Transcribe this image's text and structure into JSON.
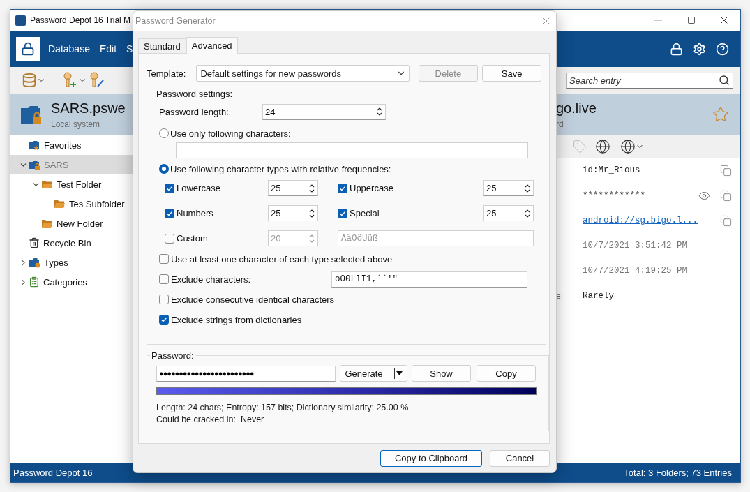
{
  "main_window": {
    "title": "Password Depot 16 Trial M",
    "menu": [
      "Database",
      "Edit",
      "S"
    ],
    "search": {
      "placeholder": "Search entry"
    },
    "database": {
      "name": "SARS.pswe",
      "location": "Local system"
    },
    "entry": {
      "title": "go.live",
      "subtitle": "rd"
    },
    "sidebar": {
      "items": [
        {
          "label": "Favorites",
          "kind": "favorites",
          "selected": false
        },
        {
          "label": "SARS",
          "kind": "database",
          "selected": true,
          "expanded": true,
          "children": [
            {
              "label": "Test Folder",
              "kind": "folder",
              "selected": false,
              "expanded": true,
              "children": [
                {
                  "label": "Tes Subfolder",
                  "kind": "folder",
                  "selected": false
                }
              ]
            },
            {
              "label": "New Folder",
              "kind": "folder",
              "selected": false
            }
          ]
        },
        {
          "label": "Recycle Bin",
          "kind": "recycle",
          "selected": false
        },
        {
          "label": "Types",
          "kind": "types",
          "selected": false,
          "expanded": false
        },
        {
          "label": "Categories",
          "kind": "categories",
          "selected": false,
          "expanded": false
        }
      ]
    },
    "fields": [
      {
        "kind": "text",
        "value": "id:Mr_Rious",
        "copyable": true
      },
      {
        "kind": "password",
        "value": "************",
        "copyable": true
      },
      {
        "kind": "link",
        "value": "android://sg.bigo.l...",
        "copyable": true
      },
      {
        "kind": "date",
        "value": "10/7/2021 3:51:42 PM",
        "copyable": false
      },
      {
        "kind": "date",
        "value": "10/7/2021 4:19:25 PM",
        "copyable": false
      },
      {
        "kind": "text",
        "label": "e:",
        "value": "Rarely",
        "copyable": false
      }
    ],
    "status_bar": [
      "Password Depot 16",
      "Total: 3 Folders; 73 Entries"
    ]
  },
  "dialog": {
    "title": "Password Generator",
    "tabs": [
      {
        "label": "Standard",
        "selected": false
      },
      {
        "label": "Advanced",
        "selected": true
      }
    ],
    "template": {
      "label": "Template:",
      "value": "Default settings for new passwords"
    },
    "template_buttons": [
      {
        "label": "Delete",
        "disabled": true
      },
      {
        "label": "Save",
        "disabled": false
      }
    ],
    "settings": {
      "title": "Password settings:",
      "length": {
        "label": "Password length:",
        "value": "24"
      },
      "modes": [
        {
          "kind": "chars",
          "label": "Use only following characters:",
          "selected": false
        },
        {
          "kind": "types",
          "label": "Use following character types with relative frequencies:",
          "selected": true
        }
      ],
      "char_types": [
        {
          "label": "Lowercase",
          "checked": true,
          "value": "25",
          "disabled": false
        },
        {
          "label": "Uppercase",
          "checked": true,
          "value": "25",
          "disabled": false
        },
        {
          "label": "Numbers",
          "checked": true,
          "value": "25",
          "disabled": false
        },
        {
          "label": "Special",
          "checked": true,
          "value": "25",
          "disabled": false
        },
        {
          "label": "Custom",
          "checked": false,
          "value": "20",
          "disabled": true,
          "chars": "ÄäÖöÜüß"
        }
      ],
      "options": [
        {
          "label": "Use at least one character of each type selected above",
          "checked": false
        },
        {
          "label": "Exclude characters:",
          "checked": false,
          "value": "oO0LlI1,´`'\""
        },
        {
          "label": "Exclude consecutive identical characters",
          "checked": false
        },
        {
          "label": "Exclude strings from dictionaries",
          "checked": true
        }
      ]
    },
    "password": {
      "title": "Password:",
      "value": "●●●●●●●●●●●●●●●●●●●●●●●●",
      "buttons": [
        {
          "label": "Generate",
          "kind": "split"
        },
        {
          "label": "Show",
          "kind": "plain"
        },
        {
          "label": "Copy",
          "kind": "plain"
        }
      ],
      "strength": {
        "level": 1
      },
      "stats": "Length: 24 chars; Entropy: 157 bits; Dictionary similarity: 25.00 %",
      "crack_time": "Could be cracked in:  Never"
    },
    "buttons": [
      {
        "label": "Copy to Clipboard",
        "default": true
      },
      {
        "label": "Cancel",
        "default": false
      }
    ]
  }
}
